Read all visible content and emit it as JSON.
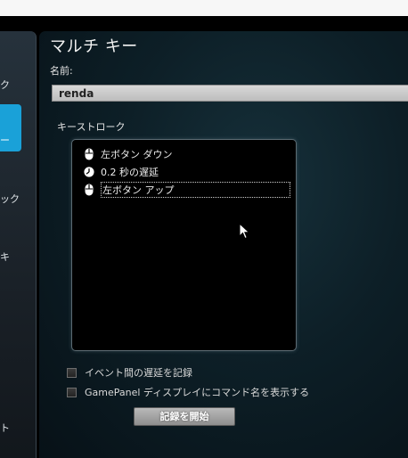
{
  "sidebar": {
    "labels": [
      "ク",
      "ー",
      "ック",
      "キ",
      "ト"
    ]
  },
  "panel": {
    "title": "マルチ キー",
    "name_label": "名前:",
    "name_value": "renda",
    "keystroke_label": "キーストローク"
  },
  "keystrokes": [
    {
      "icon": "mouse-icon",
      "label": "左ボタン ダウン"
    },
    {
      "icon": "clock-icon",
      "label": "0.2 秒の遅延"
    },
    {
      "icon": "mouse-icon",
      "label": "左ボタン アップ"
    }
  ],
  "options": {
    "record_delay_label": "イベント間の遅延を記録",
    "gamepanel_label": "GamePanel ディスプレイにコマンド名を表示する"
  },
  "record_button_label": "記録を開始"
}
